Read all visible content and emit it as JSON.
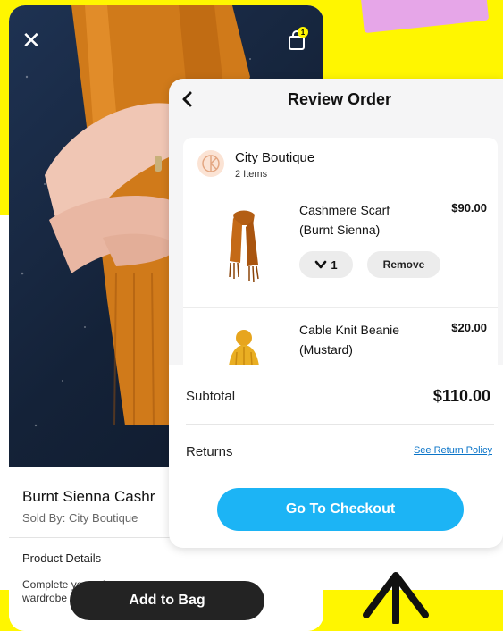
{
  "colors": {
    "background": "#FFF600",
    "accent": "#1CB4F5",
    "dark_button": "#232323"
  },
  "product": {
    "close_icon": "close-icon",
    "bag_icon": "shopping-bag-icon",
    "bag_badge": "1",
    "title": "Burnt Sienna Cashr",
    "seller": "Sold By: City Boutique",
    "details_heading": "Product Details",
    "description": "Complete your winter wardrobe with the k comfy ca",
    "add_to_bag": "Add to Bag"
  },
  "review_order": {
    "title": "Review Order",
    "back_icon": "chevron-left-icon",
    "store": {
      "name": "City Boutique",
      "items_count": "2 Items"
    },
    "items": [
      {
        "name": "Cashmere Scarf (Burnt Sienna)",
        "price": "$90.00",
        "quantity": "1",
        "remove_label": "Remove"
      },
      {
        "name": "Cable Knit Beanie (Mustard)",
        "price": "$20.00"
      }
    ],
    "subtotal_label": "Subtotal",
    "subtotal_value": "$110.00",
    "returns_label": "Returns",
    "return_policy_link": "See Return Policy",
    "checkout_label": "Go To Checkout"
  }
}
